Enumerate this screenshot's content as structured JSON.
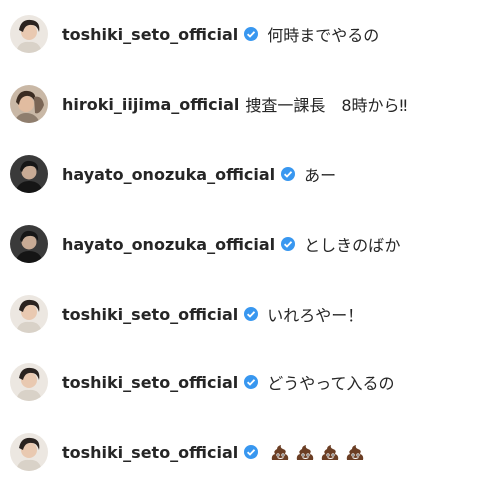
{
  "colors": {
    "verified_badge": "#3897f0",
    "username_text": "#262626",
    "comment_text": "#262626"
  },
  "comments": [
    {
      "username": "toshiki_seto_official",
      "verified": true,
      "text": "何時までやるの",
      "avatar": "toshiki-avatar"
    },
    {
      "username": "hiroki_iijima_official",
      "verified": false,
      "text": "捜査一課長　8時から‼",
      "avatar": "hiroki-avatar"
    },
    {
      "username": "hayato_onozuka_official",
      "verified": true,
      "text": "あー",
      "avatar": "hayato-avatar"
    },
    {
      "username": "hayato_onozuka_official",
      "verified": true,
      "text": "としきのばか",
      "avatar": "hayato-avatar"
    },
    {
      "username": "toshiki_seto_official",
      "verified": true,
      "text": "いれろやー！",
      "avatar": "toshiki-avatar"
    },
    {
      "username": "toshiki_seto_official",
      "verified": true,
      "text": "どうやって入るの",
      "avatar": "toshiki-avatar"
    },
    {
      "username": "toshiki_seto_official",
      "verified": true,
      "text": "",
      "emoji": "pile-of-poo",
      "emoji_count": 4,
      "avatar": "toshiki-avatar"
    }
  ]
}
